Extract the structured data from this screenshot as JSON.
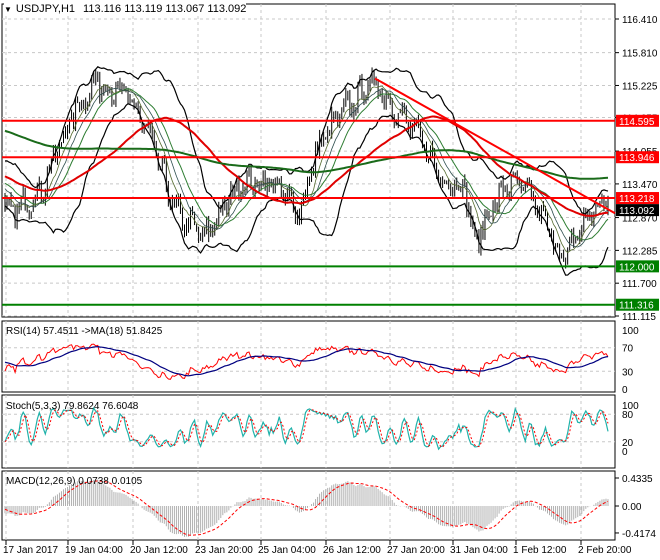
{
  "header": {
    "symbol": "USDJPY,H1",
    "ohlc": "113.116 113.119 113.067 113.092"
  },
  "colors": {
    "candle": "#000000",
    "bollinger": "#000000",
    "ma_red": "#e00000",
    "ma_green": "#1a6b1a",
    "level_red": "#ff0000",
    "level_green": "#008000",
    "rsi": "#ff0000",
    "rsi_ma": "#000080",
    "stoch_main": "#20b2aa",
    "stoch_signal": "#ff0000",
    "macd_hist": "#b0b0b0",
    "macd_signal": "#ff0000"
  },
  "chart_data": [
    {
      "type": "candlestick",
      "title": "USDJPY,H1",
      "price_ticks": [
        "116.410",
        "115.810",
        "115.225",
        "114.655",
        "114.055",
        "113.470",
        "112.870",
        "112.285",
        "111.700",
        "111.115"
      ],
      "ylim": [
        111.115,
        116.41
      ],
      "levels": [
        {
          "label": "114.595",
          "value": 114.595,
          "color": "red"
        },
        {
          "label": "113.946",
          "value": 113.946,
          "color": "red"
        },
        {
          "label": "113.218",
          "value": 113.218,
          "color": "red"
        },
        {
          "label": "112.000",
          "value": 112.0,
          "color": "green"
        },
        {
          "label": "111.316",
          "value": 111.316,
          "color": "green"
        }
      ],
      "current_price": {
        "label": "113.092",
        "value": 113.092
      },
      "trendline": {
        "from": {
          "bar": "26 Jan 12:00",
          "price": 115.35
        },
        "to": {
          "bar": "2 Feb 20:00",
          "price": 113.0
        }
      },
      "close_anchors": [
        112.9,
        113.3,
        114.6,
        115.3,
        115.0,
        114.3,
        113.0,
        112.5,
        113.5,
        113.5,
        113.0,
        114.2,
        114.8,
        115.3,
        114.8,
        114.3,
        113.6,
        113.4,
        112.4,
        113.0,
        113.5,
        113.3,
        112.6,
        112.1,
        112.7,
        113.1
      ],
      "x_labels": [
        "17 Jan 2017",
        "19 Jan 04:00",
        "20 Jan 12:00",
        "23 Jan 20:00",
        "25 Jan 04:00",
        "26 Jan 12:00",
        "27 Jan 20:00",
        "31 Jan 04:00",
        "1 Feb 12:00",
        "2 Feb 20:00"
      ]
    },
    {
      "type": "line",
      "title": "RSI(14) 57.4511  ->MA(18) 51.8425",
      "ticks": [
        "100",
        "70",
        "30",
        "0"
      ],
      "ylim": [
        0,
        100
      ]
    },
    {
      "type": "line",
      "title": "Stoch(5,3,3) 79.8624 76.6048",
      "ticks": [
        "100",
        "80",
        "20",
        "0"
      ],
      "ylim": [
        0,
        100
      ]
    },
    {
      "type": "bar",
      "title": "MACD(12,26,9) 0.0738 0.0105",
      "ticks": [
        "0.4335",
        "0.00",
        "-0.4174"
      ],
      "ylim": [
        -0.4174,
        0.4335
      ]
    }
  ]
}
